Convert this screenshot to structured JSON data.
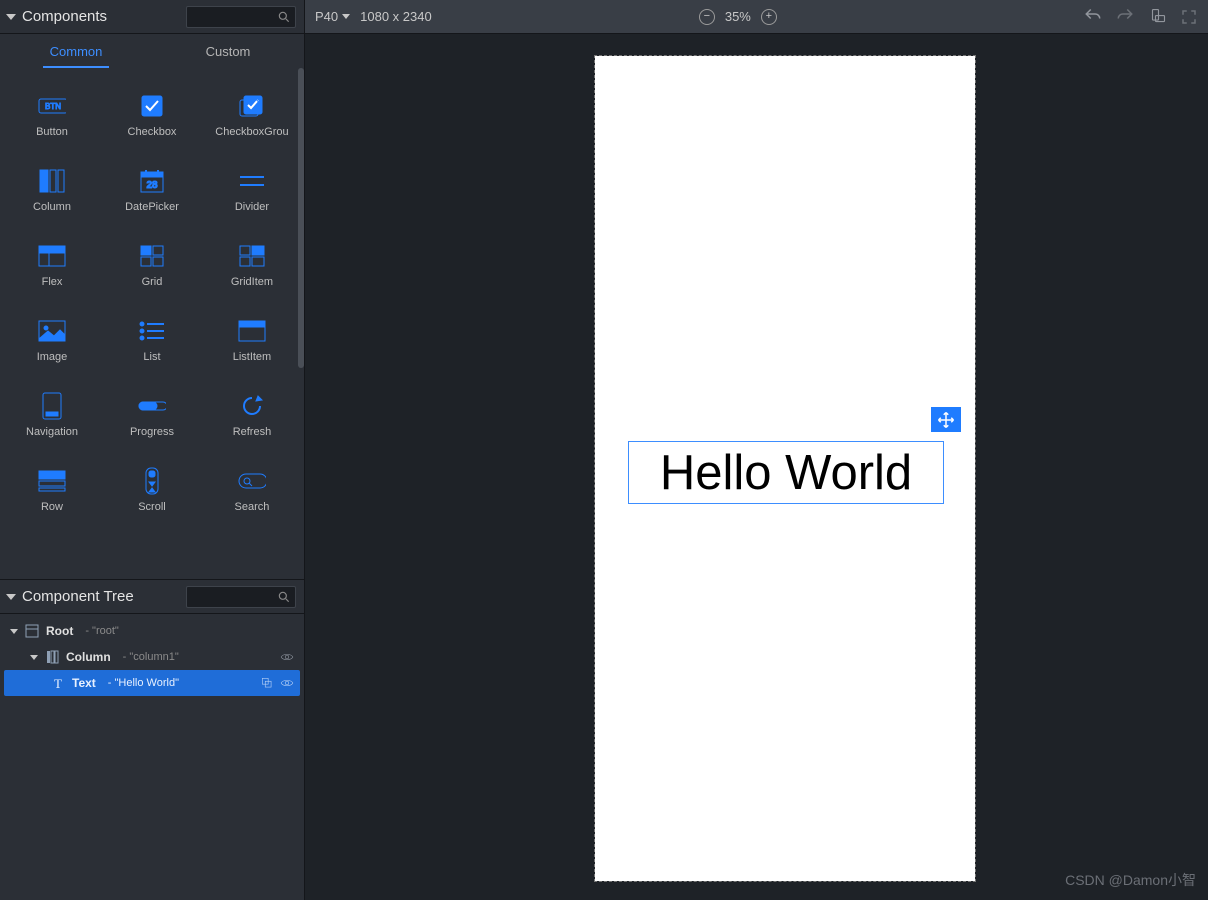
{
  "componentsPanel": {
    "title": "Components",
    "searchPlaceholder": "",
    "tabs": {
      "common": "Common",
      "custom": "Custom",
      "active": "common"
    },
    "items": [
      {
        "key": "button",
        "label": "Button"
      },
      {
        "key": "checkbox",
        "label": "Checkbox"
      },
      {
        "key": "checkboxgroup",
        "label": "CheckboxGrou"
      },
      {
        "key": "column",
        "label": "Column"
      },
      {
        "key": "datepicker",
        "label": "DatePicker"
      },
      {
        "key": "divider",
        "label": "Divider"
      },
      {
        "key": "flex",
        "label": "Flex"
      },
      {
        "key": "grid",
        "label": "Grid"
      },
      {
        "key": "griditem",
        "label": "GridItem"
      },
      {
        "key": "image",
        "label": "Image"
      },
      {
        "key": "list",
        "label": "List"
      },
      {
        "key": "listitem",
        "label": "ListItem"
      },
      {
        "key": "navigation",
        "label": "Navigation"
      },
      {
        "key": "progress",
        "label": "Progress"
      },
      {
        "key": "refresh",
        "label": "Refresh"
      },
      {
        "key": "row",
        "label": "Row"
      },
      {
        "key": "scroll",
        "label": "Scroll"
      },
      {
        "key": "search",
        "label": "Search"
      }
    ]
  },
  "treePanel": {
    "title": "Component Tree",
    "searchPlaceholder": "",
    "nodes": {
      "root": {
        "name": "Root",
        "value": "- \"root\""
      },
      "column": {
        "name": "Column",
        "value": "- \"column1\""
      },
      "text": {
        "name": "Text",
        "value": "- \"Hello World\""
      }
    }
  },
  "toolbar": {
    "device": "P40",
    "resolution": "1080 x 2340",
    "zoom": "35%"
  },
  "canvas": {
    "text": "Hello World"
  },
  "watermark": "CSDN @Damon小智"
}
